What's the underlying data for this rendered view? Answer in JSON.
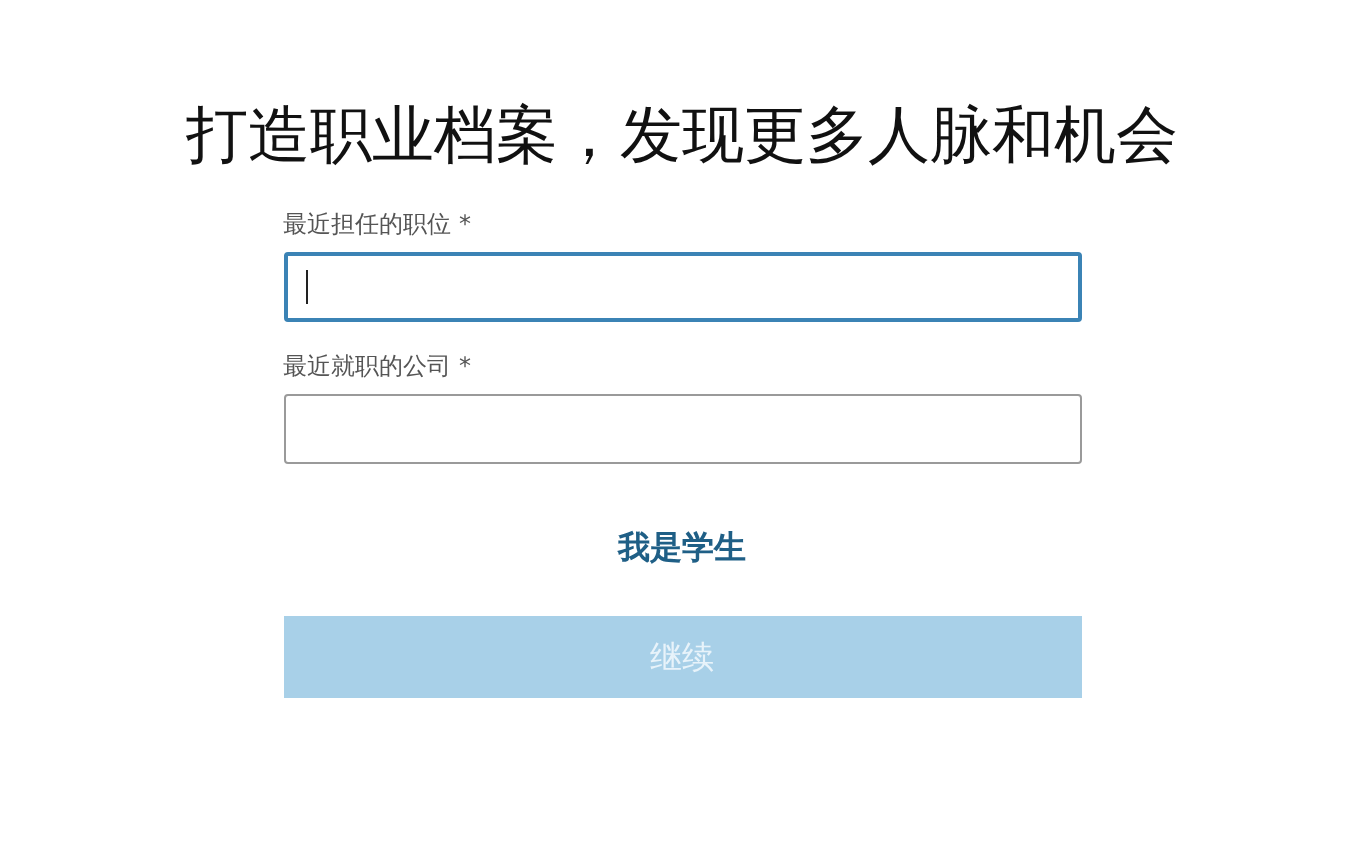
{
  "heading": "打造职业档案，发现更多人脉和机会",
  "fields": [
    {
      "label": "最近担任的职位",
      "required_mark": "*",
      "focused": true
    },
    {
      "label": "最近就职的公司",
      "required_mark": "*",
      "focused": false
    }
  ],
  "student_link": "我是学生",
  "continue_button": {
    "label": "继续",
    "disabled": true
  }
}
